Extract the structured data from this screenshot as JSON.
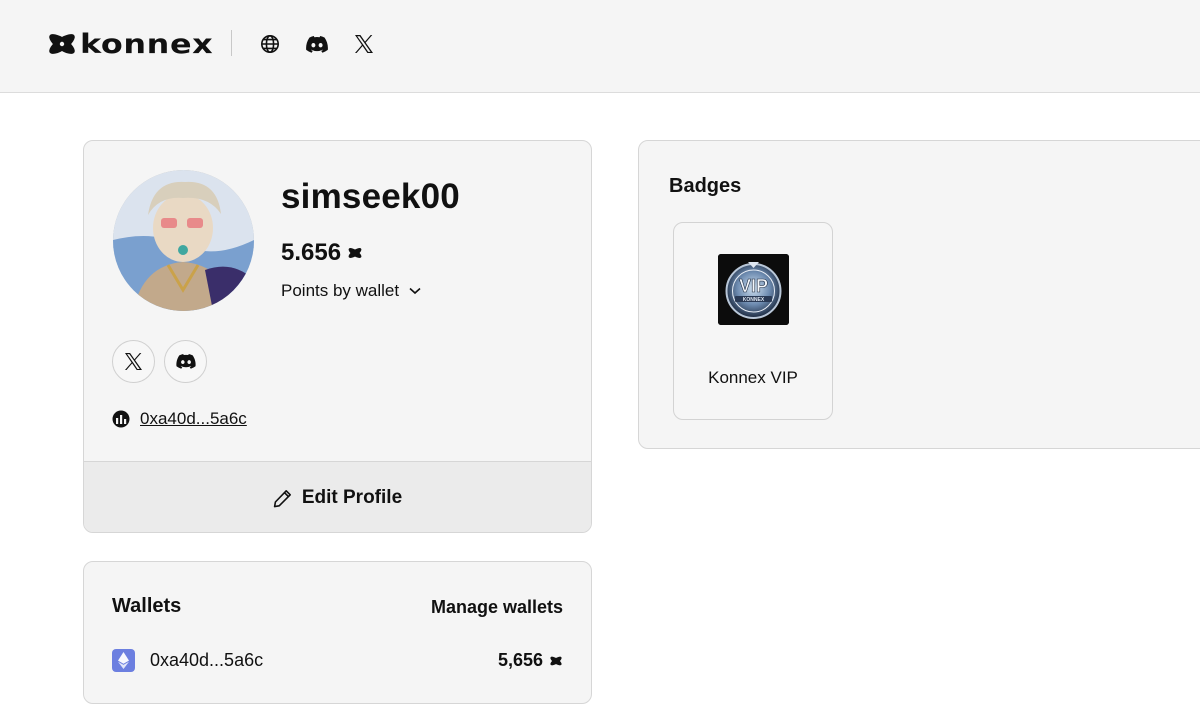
{
  "header": {
    "brand": "konnex",
    "icons": [
      "globe-icon",
      "discord-icon",
      "x-icon"
    ]
  },
  "profile": {
    "username": "simseek00",
    "points": "5.656",
    "points_by_wallet_label": "Points by wallet",
    "socials": [
      "x-icon",
      "discord-icon"
    ],
    "address": "0xa40d...5a6c",
    "edit_profile_label": "Edit Profile"
  },
  "badges": {
    "title": "Badges",
    "items": [
      {
        "label": "Konnex VIP",
        "image_text": "VIP",
        "image_subtext": "KONNEX"
      }
    ]
  },
  "wallets": {
    "title": "Wallets",
    "manage_label": "Manage wallets",
    "items": [
      {
        "address": "0xa40d...5a6c",
        "points": "5,656",
        "chain_icon": "ethereum-icon"
      }
    ]
  },
  "colors": {
    "card_bg": "#f5f5f5",
    "edit_bg": "#ebebeb",
    "eth_blue": "#6c7fe0",
    "text": "#111111"
  }
}
